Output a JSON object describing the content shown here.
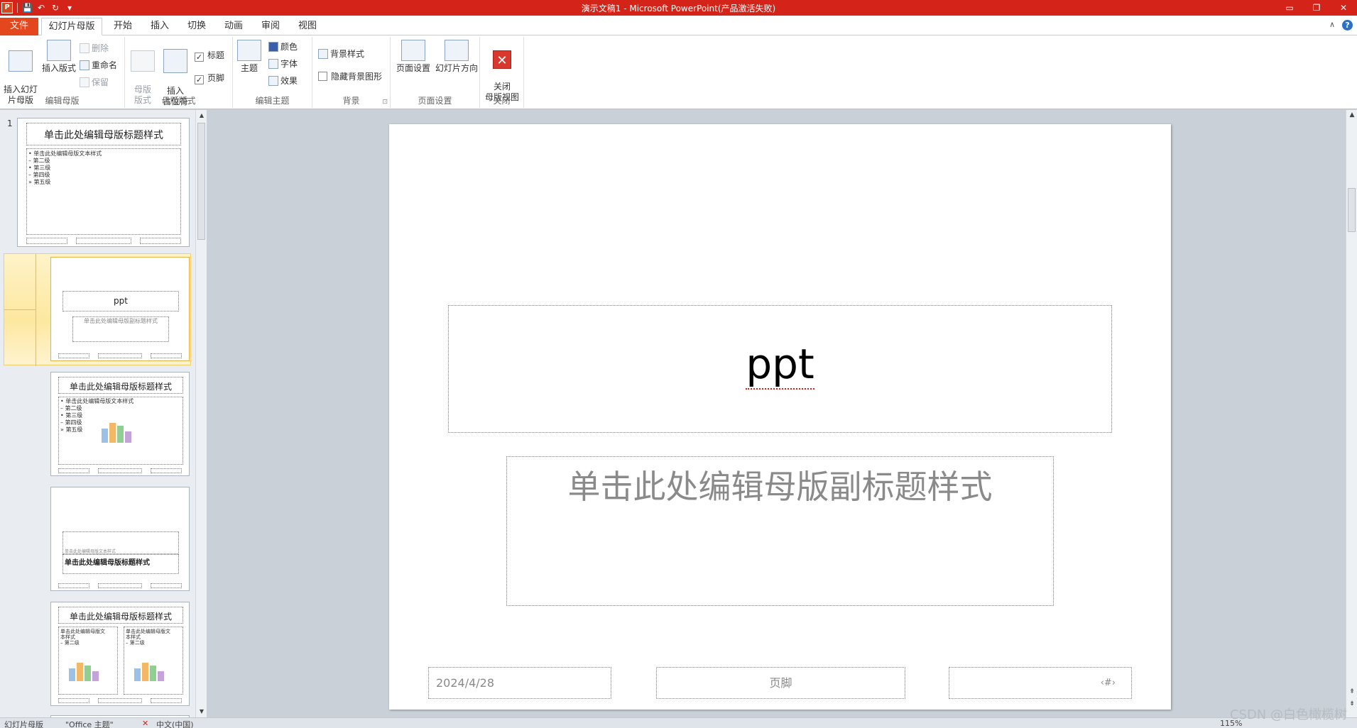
{
  "window": {
    "title": "演示文稿1 - Microsoft PowerPoint(产品激活失败)",
    "minimize": "▭",
    "restore": "❐",
    "close": "✕"
  },
  "qat": {
    "app_icon_letter": "P",
    "save_icon": "💾",
    "undo_icon": "↶",
    "redo_icon": "↻",
    "customize_icon": "▾"
  },
  "tabs": [
    "文件",
    "幻灯片母版",
    "开始",
    "插入",
    "切换",
    "动画",
    "审阅",
    "视图"
  ],
  "help": {
    "collapse": "∧",
    "help_glyph": "?"
  },
  "ribbon": {
    "edit_master": {
      "label": "编辑母版",
      "insert_slide_master": "插入幻灯\n片母版",
      "insert_layout": "插入版式",
      "delete": "删除",
      "rename": "重命名",
      "preserve": "保留"
    },
    "master_layout": {
      "label": "母版版式",
      "master_layout_btn": "母版\n版式",
      "insert_placeholder": "插入\n占位符",
      "title_check": "标题",
      "footer_check": "页脚",
      "check_mark": "✓"
    },
    "edit_theme": {
      "label": "编辑主题",
      "themes": "主题",
      "colors": "颜色",
      "fonts": "字体",
      "effects": "效果"
    },
    "background": {
      "label": "背景",
      "bg_styles": "背景样式",
      "hide_bg": "隐藏背景图形",
      "launcher": "⊡"
    },
    "page_setup": {
      "label": "页面设置",
      "page_setup_btn": "页面设置",
      "orientation": "幻灯片方向"
    },
    "close": {
      "label": "关闭",
      "close_master": "关闭\n母版视图",
      "close_glyph": "✕"
    }
  },
  "thumbnails": {
    "slide_number": "1",
    "t1": {
      "title": "单击此处编辑母版标题样式",
      "bullets": [
        "• 单击此处编辑母版文本样式",
        "  – 第二级",
        "    • 第三级",
        "      – 第四级",
        "        » 第五级"
      ]
    },
    "t2": {
      "title": "ppt",
      "subtitle": "单击此处编辑母版副标题样式"
    },
    "t3": {
      "title": "单击此处编辑母版标题样式",
      "bullets": [
        "• 单击此处编辑母版文本样式",
        "  – 第二级",
        "    • 第三级",
        "      – 第四级",
        "        » 第五级"
      ]
    },
    "t4": {
      "small_text": "单击此处编辑母版文本样式",
      "title": "单击此处编辑母版标题样式"
    },
    "t5": {
      "title": "单击此处编辑母版标题样式",
      "left": [
        "单击此处编辑母版文",
        "本样式",
        "  – 第二级"
      ],
      "right": [
        "单击此处编辑母版文",
        "本样式",
        "  – 第二级"
      ]
    }
  },
  "slide": {
    "title": "ppt",
    "subtitle": "单击此处编辑母版副标题样式",
    "date": "2024/4/28",
    "footer": "页脚",
    "number": "‹#›"
  },
  "statusbar": {
    "view": "幻灯片母版",
    "theme": "\"Office 主题\"",
    "language": "中文(中国)",
    "zoom": "115%"
  },
  "watermark": "CSDN @白色橄榄树"
}
